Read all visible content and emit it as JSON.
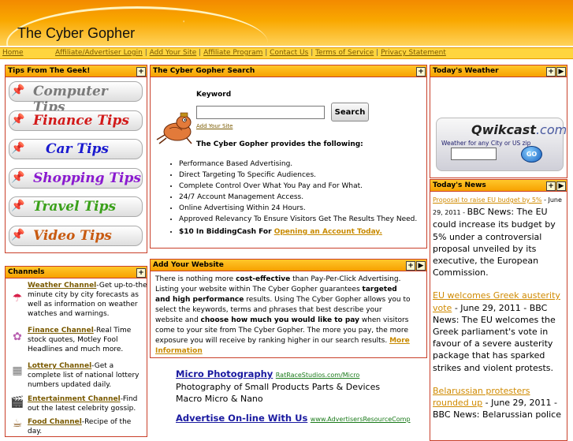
{
  "header": {
    "logo": "The Cyber Gopher",
    "sparkle": "'"
  },
  "nav": {
    "home": "Home",
    "links": [
      "Affiliate/Advertiser Login",
      "Add Your Site",
      "Affiliate Program",
      "Contact Us",
      "Terms of Service",
      "Privacy Statement"
    ]
  },
  "tips": {
    "title": "Tips From The Geek!",
    "items": [
      {
        "label": "Computer Tips",
        "color": "#7a7a7a"
      },
      {
        "label": "Finance Tips",
        "color": "#d21a1a"
      },
      {
        "label": "Car Tips",
        "color": "#1a1acf"
      },
      {
        "label": "Shopping Tips",
        "color": "#8a1acf"
      },
      {
        "label": "Travel Tips",
        "color": "#3aa01a"
      },
      {
        "label": "Video Tips",
        "color": "#c85a10"
      }
    ]
  },
  "search": {
    "title": "The Cyber Gopher Search",
    "keyword_label": "Keyword",
    "button": "Search",
    "add_site": "Add Your Site",
    "provides": "The Cyber Gopher provides the following:",
    "features": [
      "Performance Based Advertising.",
      "Direct Targeting To Specific Audiences.",
      "Complete Control Over What You Pay and For What.",
      "24/7 Account Management Access.",
      "Online Advertising Within 24 Hours.",
      "Approved Relevancy To Ensure Visitors Get The Results They Need."
    ],
    "bidding_text": "$10 In BiddingCash For ",
    "bidding_link": "Opening an Account Today."
  },
  "addsite": {
    "title": "Add Your Website",
    "p1": "There is nothing more ",
    "b1": "cost-effective",
    "p2": " than Pay-Per-Click Advertising. Listing your website within The Cyber Gopher guarantees ",
    "b2": "targeted and high performance",
    "p3": " results. Using The Cyber Gopher allows you to select the keywords, terms and phrases that best describe your website and ",
    "b3": "choose how much you would like to pay",
    "p4": " when visitors come to your site from The Cyber Gopher. The more you pay, the more exposure you will receive by ranking higher in our search results. ",
    "more": "More Information"
  },
  "channels": {
    "title": "Channels",
    "items": [
      {
        "icon": "umbrella-icon",
        "glyph": "☂",
        "name": "Weather Channel",
        "desc": "-Get up-to-the minute city by city forecasts as well as information on weather watches and warnings."
      },
      {
        "icon": "money-icon",
        "glyph": "✿",
        "name": "Finance Channel",
        "desc": "-Real Time stock quotes, Motley Fool Headlines and much more."
      },
      {
        "icon": "lottery-icon",
        "glyph": "▦",
        "name": "Lottery Channel",
        "desc": "-Get a complete list of national lottery numbers updated daily."
      },
      {
        "icon": "clapper-icon",
        "glyph": "🎬",
        "name": "Entertainment Channel",
        "desc": "-Find out the latest celebrity gossip."
      },
      {
        "icon": "food-icon",
        "glyph": "☕",
        "name": "Food Channel",
        "desc": "-Recipe of the day."
      }
    ]
  },
  "ads": [
    {
      "title": "Micro Photography",
      "url": "RatRaceStudios.com/Micro",
      "lines": [
        "Photography of Small Products Parts & Devices",
        "Macro Micro & Nano"
      ]
    },
    {
      "title": "Advertise On-line With Us",
      "url": "www.AdvertisersResourceComp",
      "lines": []
    }
  ],
  "weather": {
    "title": "Today's Weather",
    "brand": "Qwikcast",
    "brand_suffix": ".com",
    "tagline": "Weather for any City or US zip",
    "go": "GO"
  },
  "news": {
    "title": "Today's News",
    "items": [
      {
        "link": "Proposal to raise EU budget by 5%",
        "text": " - June 29, 2011 - BBC News: The EU could increase its budget by 5% under a controversial proposal unveiled by its executive, the European Commission.",
        "small": true
      },
      {
        "link": "EU welcomes Greek austerity vote",
        "text": " - June 29, 2011 - BBC News: The EU welcomes the Greek parliament's vote in favour of a severe austerity package that has sparked strikes and violent protests.",
        "small": false
      },
      {
        "link": "Belarussian protesters rounded up",
        "text": " - June 29, 2011 - BBC News: Belarussian police",
        "small": false
      }
    ]
  }
}
